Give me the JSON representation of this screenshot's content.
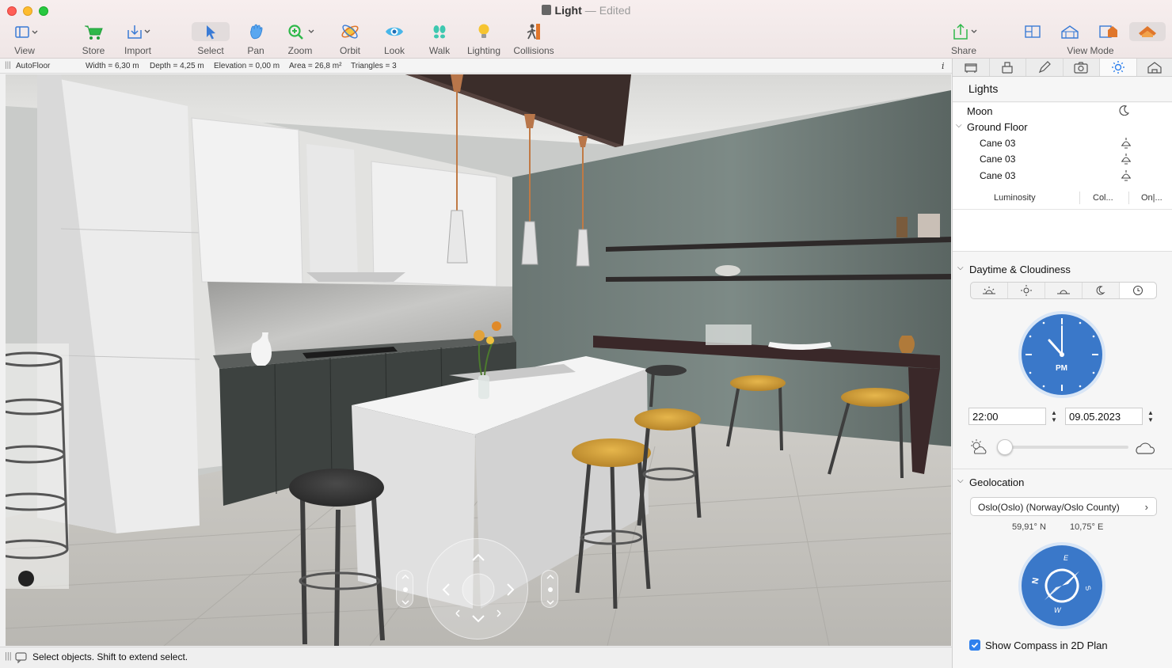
{
  "window": {
    "title": "Light",
    "status": "Edited"
  },
  "toolbar": {
    "view": "View",
    "store": "Store",
    "import": "Import",
    "select": "Select",
    "pan": "Pan",
    "zoom": "Zoom",
    "orbit": "Orbit",
    "look": "Look",
    "walk": "Walk",
    "lighting": "Lighting",
    "collisions": "Collisions",
    "share": "Share",
    "view_mode": "View Mode"
  },
  "infobar": {
    "layer": "AutoFloor",
    "width": "Width = 6,30 m",
    "depth": "Depth = 4,25 m",
    "elevation": "Elevation = 0,00 m",
    "area": "Area = 26,8 m²",
    "triangles": "Triangles = 3",
    "info_glyph": "i"
  },
  "statusbar": {
    "message": "Select objects. Shift to extend select."
  },
  "panel": {
    "title": "Lights",
    "tree": {
      "moon": "Moon",
      "ground_floor": "Ground Floor",
      "items": [
        "Cane 03",
        "Cane 03",
        "Cane 03"
      ]
    },
    "columns": [
      "Luminosity",
      "Col...",
      "On|..."
    ],
    "daytime": {
      "heading": "Daytime & Cloudiness",
      "clock_label": "PM",
      "time": "22:00",
      "date": "09.05.2023",
      "cloudiness": 0.0
    },
    "geolocation": {
      "heading": "Geolocation",
      "location": "Oslo(Oslo) (Norway/Oslo County)",
      "lat": "59,91° N",
      "lon": "10,75° E",
      "compass_letters": {
        "n": "N",
        "e": "E",
        "s": "S",
        "w": "W"
      }
    },
    "show_compass": {
      "label": "Show Compass in 2D Plan",
      "checked": true
    }
  },
  "colors": {
    "accent": "#2f80ed",
    "clock_blue": "#3a78c9",
    "wall_green": "#5d6a66",
    "stool_yellow": "#d9a53a",
    "cabinet_dark": "#3d4240"
  }
}
